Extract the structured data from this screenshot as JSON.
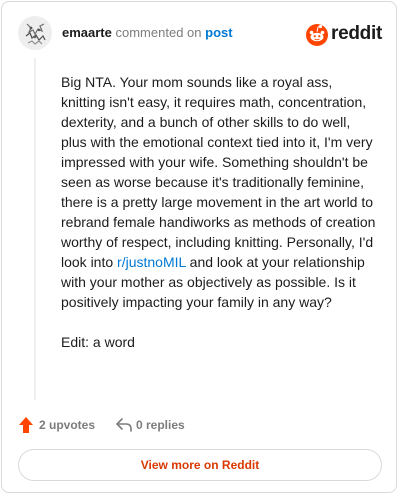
{
  "header": {
    "author": "emaarte",
    "action_text": "commented on",
    "post_link": "post",
    "brand_name": "reddit",
    "brand_color": "#ff4500"
  },
  "comment": {
    "paragraph1_before_link": "Big NTA. Your mom sounds like a royal ass, knitting isn't easy, it requires math, concentration, dexterity, and a bunch of other skills to do well, plus with the emotional context tied into it, I'm very impressed with your wife. Something shouldn't be seen as worse because it's traditionally feminine, there is a pretty large movement in the art world to rebrand female handiworks as methods of creation worthy of respect, including knitting. Personally, I'd look into ",
    "subreddit_link": "r/justnoMIL",
    "paragraph1_after_link": " and look at your relationship with your mother as objectively as possible. Is it positively impacting your family in any way?",
    "paragraph2": "Edit: a word",
    "link_color": "#0079d3"
  },
  "actions": {
    "upvotes_label": "2 upvotes",
    "replies_label": "0 replies",
    "upvote_icon": "upvote-arrow-icon",
    "reply_icon": "reply-arrow-icon",
    "upvote_color": "#ff4500"
  },
  "footer": {
    "view_more_label": "View more on Reddit",
    "view_more_color": "#d93a00"
  }
}
